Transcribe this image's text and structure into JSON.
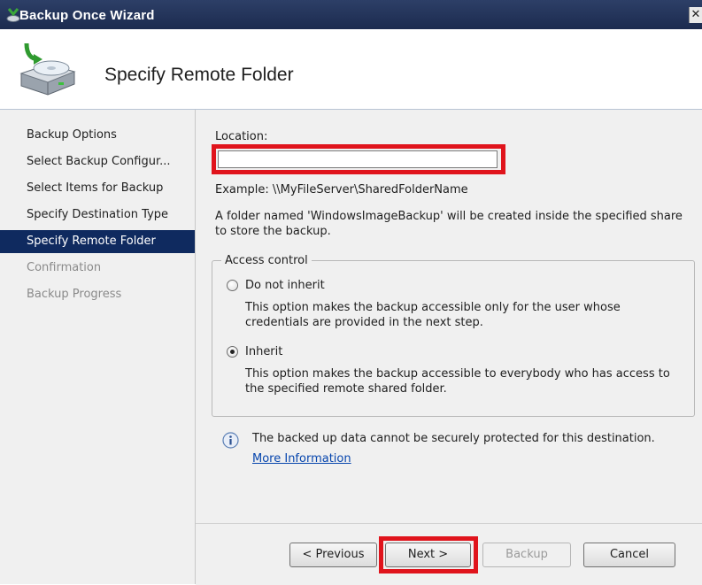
{
  "window": {
    "title": "Backup Once Wizard",
    "close_glyph": "✕"
  },
  "header": {
    "title": "Specify Remote Folder",
    "icon": "backup-drive-icon"
  },
  "sidebar": {
    "steps": [
      {
        "label": "Backup Options",
        "state": "normal"
      },
      {
        "label": "Select Backup Configur...",
        "state": "normal"
      },
      {
        "label": "Select Items for Backup",
        "state": "normal"
      },
      {
        "label": "Specify Destination Type",
        "state": "normal"
      },
      {
        "label": "Specify Remote Folder",
        "state": "active"
      },
      {
        "label": "Confirmation",
        "state": "disabled"
      },
      {
        "label": "Backup Progress",
        "state": "disabled"
      }
    ]
  },
  "main": {
    "location_label": "Location:",
    "location_value": "",
    "example_text": "Example: \\\\MyFileServer\\SharedFolderName",
    "folder_note_line1": "A folder named 'WindowsImageBackup' will be created inside the specified share",
    "folder_note_line2": "to store the backup.",
    "access_control": {
      "legend": "Access control",
      "selected": "Inherit",
      "options": [
        {
          "label": "Do not inherit",
          "desc_line1": "This option makes the backup accessible only for the user whose",
          "desc_line2": "credentials are provided in the next step."
        },
        {
          "label": "Inherit",
          "desc_line1": "This option makes the backup accessible to everybody who has access to",
          "desc_line2": "the specified remote shared folder."
        }
      ]
    },
    "info_text": "The backed up data cannot be securely protected for this destination.",
    "info_link": "More Information"
  },
  "footer": {
    "previous": "< Previous",
    "next": "Next >",
    "backup": "Backup",
    "cancel": "Cancel"
  },
  "colors": {
    "highlight": "#e0141c",
    "active_step": "#0f2a5f",
    "titlebar": "#1c2b4f",
    "link": "#0645ad"
  }
}
